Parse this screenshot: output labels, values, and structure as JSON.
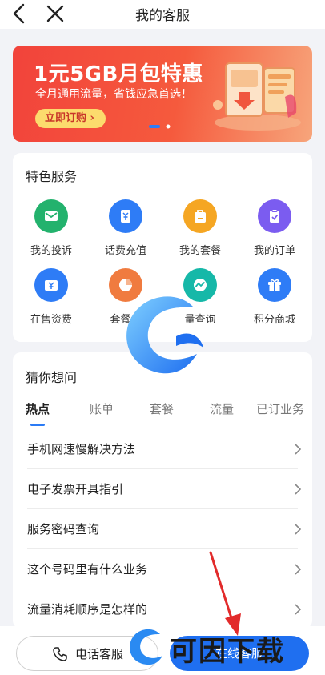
{
  "header": {
    "title": "我的客服",
    "back_icon": "chevron-left-icon",
    "close_icon": "close-icon"
  },
  "banner": {
    "title": "1元5GB月包特惠",
    "subtitle": "全月通用流量，省钱应急首选！",
    "button_label": "立即订购 ›",
    "page_indicator": {
      "count": 2,
      "active": 1
    }
  },
  "services": {
    "title": "特色服务",
    "items": [
      {
        "label": "我的投诉",
        "icon": "mail-icon",
        "color": "#23b26d"
      },
      {
        "label": "话费充值",
        "icon": "yuan-card-icon",
        "color": "#2e7cf6"
      },
      {
        "label": "我的套餐",
        "icon": "bag-icon",
        "color": "#f5a623"
      },
      {
        "label": "我的订单",
        "icon": "clipboard-check-icon",
        "color": "#7b5cf0"
      },
      {
        "label": "在售资费",
        "icon": "yuan-tag-icon",
        "color": "#2e7cf6"
      },
      {
        "label": "套餐余",
        "icon": "pie-chart-icon",
        "color": "#f07b3f"
      },
      {
        "label": "量查询",
        "icon": "wave-chart-icon",
        "color": "#16b8a8"
      },
      {
        "label": "积分商城",
        "icon": "gift-icon",
        "color": "#2e7cf6"
      }
    ]
  },
  "faq": {
    "title": "猜你想问",
    "tabs": [
      "热点",
      "账单",
      "套餐",
      "流量",
      "已订业务"
    ],
    "active_tab": 0,
    "questions": [
      "手机网速慢解决方法",
      "电子发票开具指引",
      "服务密码查询",
      "这个号码里有什么业务",
      "流量消耗顺序是怎样的"
    ]
  },
  "bottom": {
    "phone_label": "电话客服",
    "online_label": "在线客服"
  },
  "watermark": {
    "text": "可因下载"
  },
  "colors": {
    "accent": "#1f6ff0",
    "banner": "#f2433b",
    "page_bg": "#f2f3f7"
  }
}
